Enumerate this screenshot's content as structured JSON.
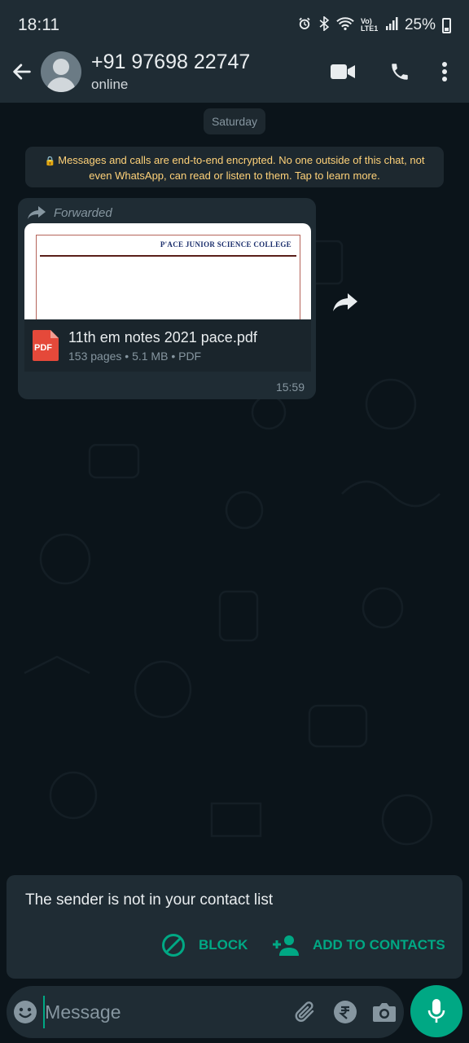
{
  "status_bar": {
    "time": "18:11",
    "network_label": "Vo) LTE1",
    "battery": "25%"
  },
  "header": {
    "contact_name": "+91 97698 22747",
    "contact_status": "online"
  },
  "chat": {
    "date_chip": "Saturday",
    "encryption_notice": "Messages and calls are end-to-end encrypted. No one outside of this chat, not even WhatsApp, can read or listen to them. Tap to learn more.",
    "message": {
      "forwarded_label": "Forwarded",
      "preview_logo_text": "P'ACE JUNIOR SCIENCE COLLEGE",
      "file_icon_label": "PDF",
      "file_name": "11th em notes 2021 pace.pdf",
      "file_meta": "153 pages • 5.1 MB • PDF",
      "time": "15:59"
    }
  },
  "sender_card": {
    "text": "The sender is not in your contact list",
    "block_label": "BLOCK",
    "add_label": "ADD TO CONTACTS"
  },
  "input": {
    "placeholder": "Message"
  },
  "colors": {
    "accent": "#00a884",
    "bar_bg": "#1f2c34",
    "chat_bg": "#0b141a",
    "notice_text": "#ffd279"
  },
  "icons": [
    "back-arrow-icon",
    "avatar",
    "video-call-icon",
    "phone-icon",
    "more-options-icon",
    "lock-icon",
    "forward-icon",
    "pdf-icon",
    "share-icon",
    "block-icon",
    "add-contact-icon",
    "emoji-icon",
    "attach-icon",
    "rupee-icon",
    "camera-icon",
    "mic-icon"
  ]
}
